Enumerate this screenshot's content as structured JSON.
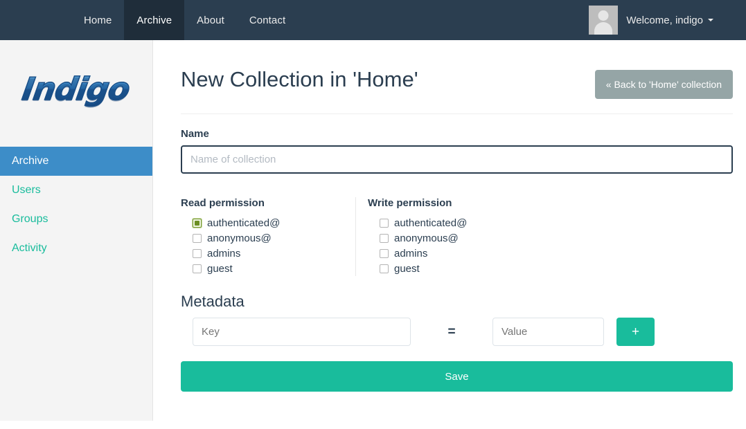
{
  "navbar": {
    "items": [
      {
        "label": "Home",
        "active": false
      },
      {
        "label": "Archive",
        "active": true
      },
      {
        "label": "About",
        "active": false
      },
      {
        "label": "Contact",
        "active": false
      }
    ],
    "user": {
      "welcome_label": "Welcome, indigo",
      "avatar_icon": "user-placeholder-icon",
      "caret_icon": "caret-down-icon"
    },
    "colors": {
      "background": "#2b3e50",
      "active_background": "#1f2d3a",
      "text": "#ebebeb"
    }
  },
  "sidebar": {
    "logo_text": "Indigo",
    "items": [
      {
        "label": "Archive",
        "active": true
      },
      {
        "label": "Users",
        "active": false
      },
      {
        "label": "Groups",
        "active": false
      },
      {
        "label": "Activity",
        "active": false
      }
    ],
    "colors": {
      "background": "#f4f4f4",
      "active_background": "#3d8dc8",
      "link": "#19bc9c"
    }
  },
  "main": {
    "page_title": "New Collection in 'Home'",
    "back_button_label": "« Back to 'Home' collection",
    "name": {
      "label": "Name",
      "placeholder": "Name of collection",
      "value": ""
    },
    "read_permission": {
      "title": "Read permission",
      "options": [
        {
          "label": "authenticated@",
          "checked": true
        },
        {
          "label": "anonymous@",
          "checked": false
        },
        {
          "label": "admins",
          "checked": false
        },
        {
          "label": "guest",
          "checked": false
        }
      ]
    },
    "write_permission": {
      "title": "Write permission",
      "options": [
        {
          "label": "authenticated@",
          "checked": false
        },
        {
          "label": "anonymous@",
          "checked": false
        },
        {
          "label": "admins",
          "checked": false
        },
        {
          "label": "guest",
          "checked": false
        }
      ]
    },
    "metadata": {
      "title": "Metadata",
      "key_placeholder": "Key",
      "key_value": "",
      "equals_label": "=",
      "value_placeholder": "Value",
      "value_value": "",
      "add_button_label": "+"
    },
    "save_button_label": "Save",
    "colors": {
      "primary": "#19bc9c",
      "secondary": "#95a5a6",
      "heading": "#2b3e50"
    }
  }
}
